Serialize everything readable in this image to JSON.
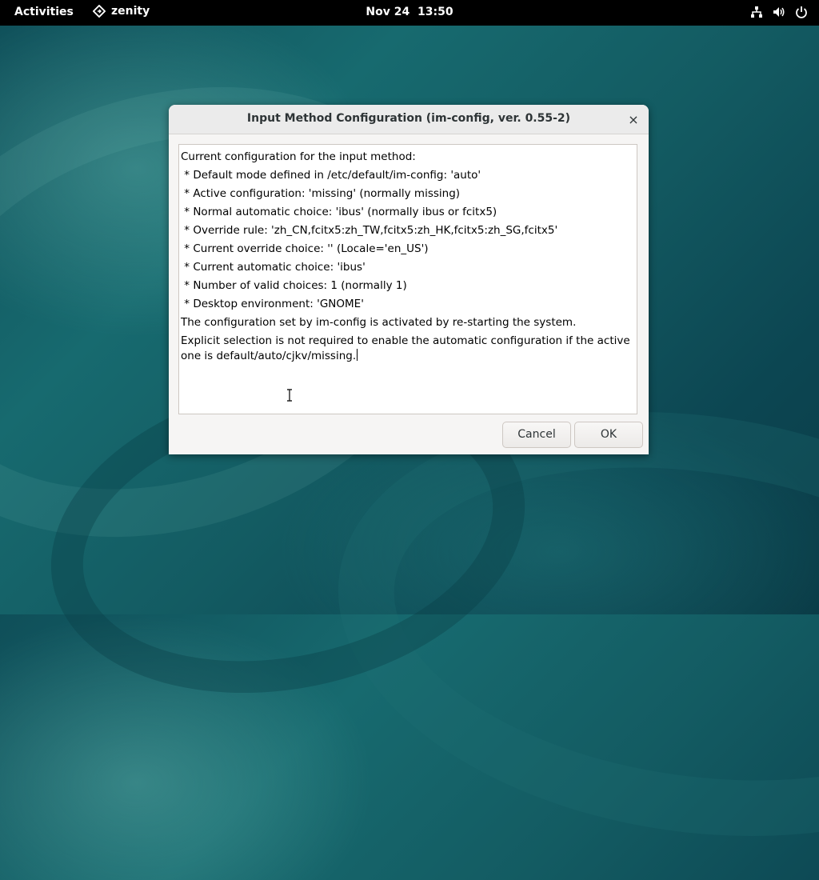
{
  "topbar": {
    "activities": "Activities",
    "app_name": "zenity",
    "app_icon": "zenity-diamond-icon",
    "clock_date": "Nov 24",
    "clock_time": "13:50",
    "tray_icons": [
      "network-icon",
      "volume-icon",
      "power-icon"
    ]
  },
  "dialog": {
    "title": "Input Method Configuration (im-config, ver. 0.55-2)",
    "close_label": "×",
    "lines": [
      "Current configuration for the input method:",
      " * Default mode defined in /etc/default/im-config: 'auto'",
      " * Active configuration: 'missing' (normally missing)",
      " * Normal automatic choice: 'ibus' (normally ibus or fcitx5)",
      " * Override rule: 'zh_CN,fcitx5:zh_TW,fcitx5:zh_HK,fcitx5:zh_SG,fcitx5'",
      " * Current override choice: '' (Locale='en_US')",
      " * Current automatic choice: 'ibus'",
      " * Number of valid choices: 1 (normally 1)",
      " * Desktop environment: 'GNOME'",
      "The configuration set by im-config is activated by re-starting the system.",
      "Explicit selection is not required to enable the automatic configuration if the active one is default/auto/cjkv/missing."
    ],
    "cancel_label": "Cancel",
    "ok_label": "OK"
  },
  "colors": {
    "topbar_bg": "#000000",
    "dialog_bg": "#f6f5f4",
    "desktop_teal": "#176a6f"
  }
}
